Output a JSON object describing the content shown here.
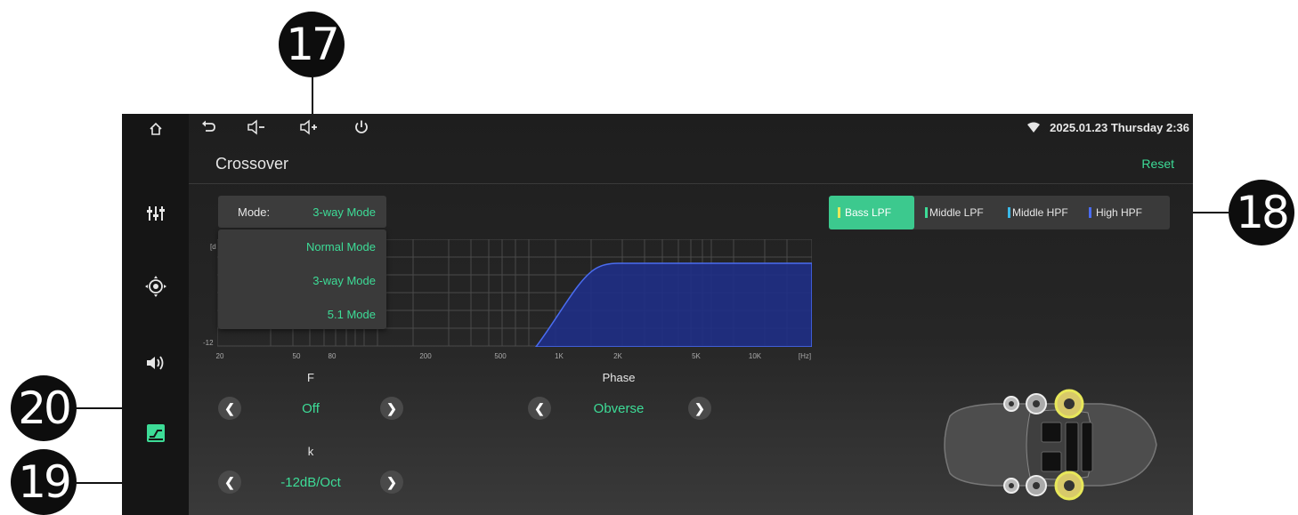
{
  "callouts": [
    "17",
    "18",
    "20",
    "19"
  ],
  "status": {
    "datetime": "2025.01.23 Thursday 2:36"
  },
  "header": {
    "title": "Crossover",
    "reset_label": "Reset"
  },
  "mode": {
    "label": "Mode:",
    "value": "3-way Mode",
    "options": [
      "Normal Mode",
      "3-way Mode",
      "5.1 Mode"
    ]
  },
  "graph": {
    "y_top_label": "[d",
    "y_bottom_label": "-12",
    "x_ticks": [
      "20",
      "50",
      "80",
      "200",
      "500",
      "1K",
      "2K",
      "5K",
      "10K",
      "[Hz]"
    ],
    "fill_color": "#1f2f86",
    "line_color": "#4a6cf0"
  },
  "filters": [
    {
      "label": "Bass LPF",
      "color": "#e8e85a",
      "active": true
    },
    {
      "label": "Middle LPF",
      "color": "#3ddc97",
      "active": false
    },
    {
      "label": "Middle HPF",
      "color": "#3ab8e8",
      "active": false
    },
    {
      "label": "High HPF",
      "color": "#4a6cf0",
      "active": false
    }
  ],
  "controls": {
    "f_label": "F",
    "f_value": "Off",
    "k_label": "k",
    "k_value": "-12dB/Oct",
    "phase_label": "Phase",
    "phase_value": "Obverse"
  },
  "accent_color": "#3ddc97"
}
